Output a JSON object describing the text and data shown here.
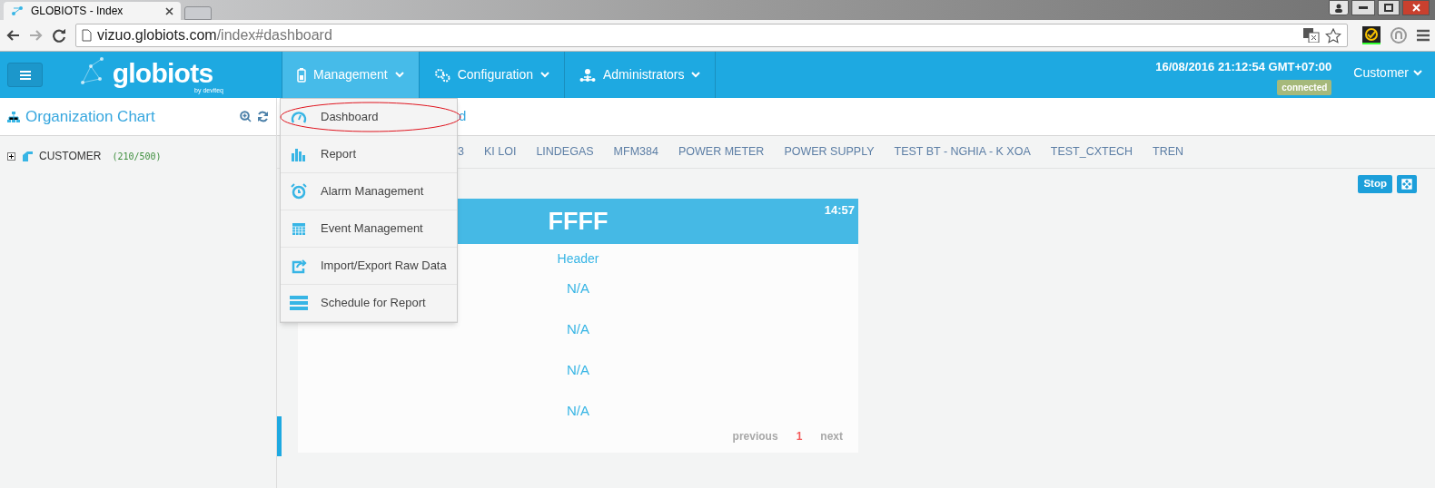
{
  "browser": {
    "tab_title": "GLOBIOTS - Index",
    "url_host": "vizuo.globiots.com",
    "url_path": "/index#dashboard"
  },
  "header": {
    "logo": "globiots",
    "logo_sub": "by deviteq",
    "nav": [
      {
        "label": "Management",
        "kind": "battery",
        "selected": true
      },
      {
        "label": "Configuration",
        "kind": "gears",
        "selected": false
      },
      {
        "label": "Administrators",
        "kind": "users",
        "selected": false
      }
    ],
    "datetime": "16/08/2016 21:12:54 GMT+07:00",
    "connection": "connected",
    "user": "Customer"
  },
  "sidebar": {
    "title": "Organization Chart",
    "tree": [
      {
        "label": "CUSTOMER",
        "count": "(210/500)",
        "expanded": false
      }
    ]
  },
  "breadcrumb": "d",
  "device_tabs": [
    "3",
    "KI LOI",
    "LINDEGAS",
    "MFM384",
    "POWER METER",
    "POWER SUPPLY",
    "TEST BT - NGHIA - K XOA",
    "TEST_CXTECH",
    "TREN"
  ],
  "controls": {
    "stop": "Stop"
  },
  "menu": [
    {
      "label": "Dashboard",
      "kind": "gauge",
      "circled": true
    },
    {
      "label": "Report",
      "kind": "bars",
      "circled": false
    },
    {
      "label": "Alarm Management",
      "kind": "alarm",
      "circled": false
    },
    {
      "label": "Event Management",
      "kind": "calendar",
      "circled": false
    },
    {
      "label": "Import/Export Raw Data",
      "kind": "share",
      "circled": false
    },
    {
      "label": "Schedule for Report",
      "kind": "server",
      "circled": false
    }
  ],
  "card": {
    "title": "FFFF",
    "time": "14:57",
    "header": "Header",
    "values": [
      "N/A",
      "N/A",
      "N/A",
      "N/A"
    ],
    "pagination": [
      {
        "label": "previous",
        "selected": false
      },
      {
        "label": "1",
        "selected": true
      },
      {
        "label": "next",
        "selected": false
      }
    ]
  }
}
